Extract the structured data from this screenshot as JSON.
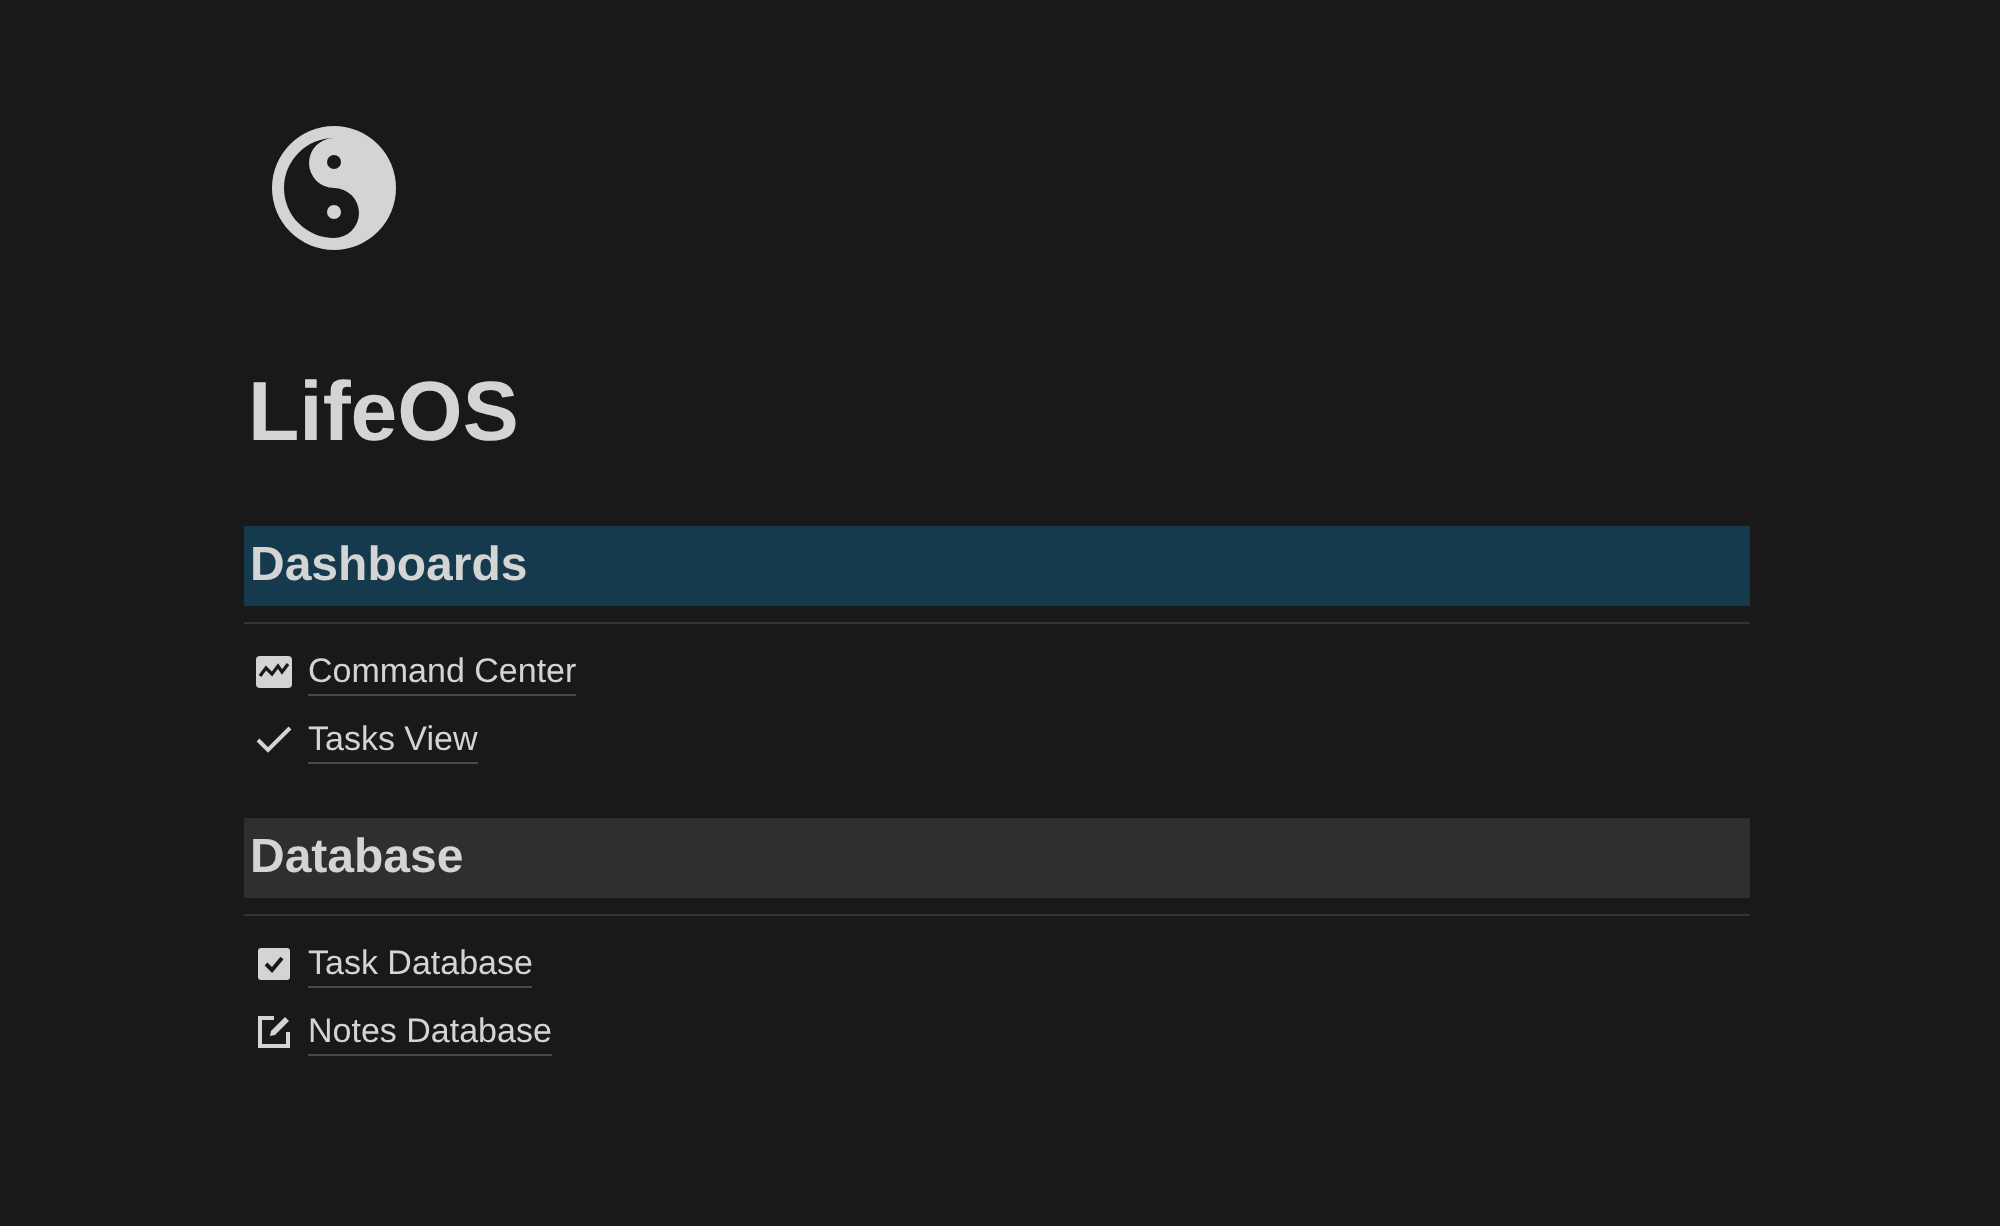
{
  "page": {
    "title": "LifeOS"
  },
  "sections": [
    {
      "heading": "Dashboards",
      "color": "#153a4d",
      "links": [
        {
          "kind": "chart",
          "label": "Command Center"
        },
        {
          "kind": "check",
          "label": "Tasks View"
        }
      ]
    },
    {
      "heading": "Database",
      "color": "#2f2f2f",
      "links": [
        {
          "kind": "checkbox",
          "label": "Task Database"
        },
        {
          "kind": "edit",
          "label": "Notes Database"
        }
      ]
    }
  ]
}
